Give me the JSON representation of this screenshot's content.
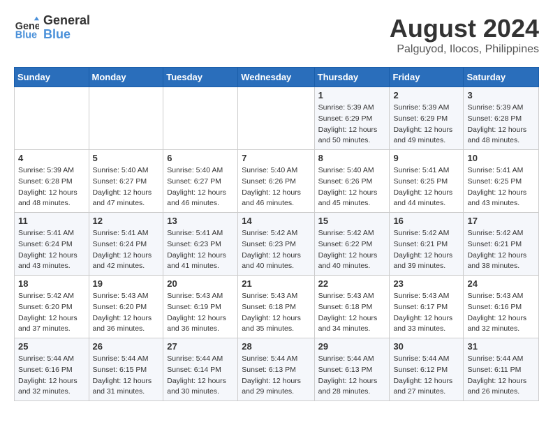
{
  "logo": {
    "line1": "General",
    "line2": "Blue"
  },
  "title": "August 2024",
  "location": "Palguyod, Ilocos, Philippines",
  "days_of_week": [
    "Sunday",
    "Monday",
    "Tuesday",
    "Wednesday",
    "Thursday",
    "Friday",
    "Saturday"
  ],
  "weeks": [
    [
      {
        "day": "",
        "info": ""
      },
      {
        "day": "",
        "info": ""
      },
      {
        "day": "",
        "info": ""
      },
      {
        "day": "",
        "info": ""
      },
      {
        "day": "1",
        "info": "Sunrise: 5:39 AM\nSunset: 6:29 PM\nDaylight: 12 hours\nand 50 minutes."
      },
      {
        "day": "2",
        "info": "Sunrise: 5:39 AM\nSunset: 6:29 PM\nDaylight: 12 hours\nand 49 minutes."
      },
      {
        "day": "3",
        "info": "Sunrise: 5:39 AM\nSunset: 6:28 PM\nDaylight: 12 hours\nand 48 minutes."
      }
    ],
    [
      {
        "day": "4",
        "info": "Sunrise: 5:39 AM\nSunset: 6:28 PM\nDaylight: 12 hours\nand 48 minutes."
      },
      {
        "day": "5",
        "info": "Sunrise: 5:40 AM\nSunset: 6:27 PM\nDaylight: 12 hours\nand 47 minutes."
      },
      {
        "day": "6",
        "info": "Sunrise: 5:40 AM\nSunset: 6:27 PM\nDaylight: 12 hours\nand 46 minutes."
      },
      {
        "day": "7",
        "info": "Sunrise: 5:40 AM\nSunset: 6:26 PM\nDaylight: 12 hours\nand 46 minutes."
      },
      {
        "day": "8",
        "info": "Sunrise: 5:40 AM\nSunset: 6:26 PM\nDaylight: 12 hours\nand 45 minutes."
      },
      {
        "day": "9",
        "info": "Sunrise: 5:41 AM\nSunset: 6:25 PM\nDaylight: 12 hours\nand 44 minutes."
      },
      {
        "day": "10",
        "info": "Sunrise: 5:41 AM\nSunset: 6:25 PM\nDaylight: 12 hours\nand 43 minutes."
      }
    ],
    [
      {
        "day": "11",
        "info": "Sunrise: 5:41 AM\nSunset: 6:24 PM\nDaylight: 12 hours\nand 43 minutes."
      },
      {
        "day": "12",
        "info": "Sunrise: 5:41 AM\nSunset: 6:24 PM\nDaylight: 12 hours\nand 42 minutes."
      },
      {
        "day": "13",
        "info": "Sunrise: 5:41 AM\nSunset: 6:23 PM\nDaylight: 12 hours\nand 41 minutes."
      },
      {
        "day": "14",
        "info": "Sunrise: 5:42 AM\nSunset: 6:23 PM\nDaylight: 12 hours\nand 40 minutes."
      },
      {
        "day": "15",
        "info": "Sunrise: 5:42 AM\nSunset: 6:22 PM\nDaylight: 12 hours\nand 40 minutes."
      },
      {
        "day": "16",
        "info": "Sunrise: 5:42 AM\nSunset: 6:21 PM\nDaylight: 12 hours\nand 39 minutes."
      },
      {
        "day": "17",
        "info": "Sunrise: 5:42 AM\nSunset: 6:21 PM\nDaylight: 12 hours\nand 38 minutes."
      }
    ],
    [
      {
        "day": "18",
        "info": "Sunrise: 5:42 AM\nSunset: 6:20 PM\nDaylight: 12 hours\nand 37 minutes."
      },
      {
        "day": "19",
        "info": "Sunrise: 5:43 AM\nSunset: 6:20 PM\nDaylight: 12 hours\nand 36 minutes."
      },
      {
        "day": "20",
        "info": "Sunrise: 5:43 AM\nSunset: 6:19 PM\nDaylight: 12 hours\nand 36 minutes."
      },
      {
        "day": "21",
        "info": "Sunrise: 5:43 AM\nSunset: 6:18 PM\nDaylight: 12 hours\nand 35 minutes."
      },
      {
        "day": "22",
        "info": "Sunrise: 5:43 AM\nSunset: 6:18 PM\nDaylight: 12 hours\nand 34 minutes."
      },
      {
        "day": "23",
        "info": "Sunrise: 5:43 AM\nSunset: 6:17 PM\nDaylight: 12 hours\nand 33 minutes."
      },
      {
        "day": "24",
        "info": "Sunrise: 5:43 AM\nSunset: 6:16 PM\nDaylight: 12 hours\nand 32 minutes."
      }
    ],
    [
      {
        "day": "25",
        "info": "Sunrise: 5:44 AM\nSunset: 6:16 PM\nDaylight: 12 hours\nand 32 minutes."
      },
      {
        "day": "26",
        "info": "Sunrise: 5:44 AM\nSunset: 6:15 PM\nDaylight: 12 hours\nand 31 minutes."
      },
      {
        "day": "27",
        "info": "Sunrise: 5:44 AM\nSunset: 6:14 PM\nDaylight: 12 hours\nand 30 minutes."
      },
      {
        "day": "28",
        "info": "Sunrise: 5:44 AM\nSunset: 6:13 PM\nDaylight: 12 hours\nand 29 minutes."
      },
      {
        "day": "29",
        "info": "Sunrise: 5:44 AM\nSunset: 6:13 PM\nDaylight: 12 hours\nand 28 minutes."
      },
      {
        "day": "30",
        "info": "Sunrise: 5:44 AM\nSunset: 6:12 PM\nDaylight: 12 hours\nand 27 minutes."
      },
      {
        "day": "31",
        "info": "Sunrise: 5:44 AM\nSunset: 6:11 PM\nDaylight: 12 hours\nand 26 minutes."
      }
    ]
  ]
}
